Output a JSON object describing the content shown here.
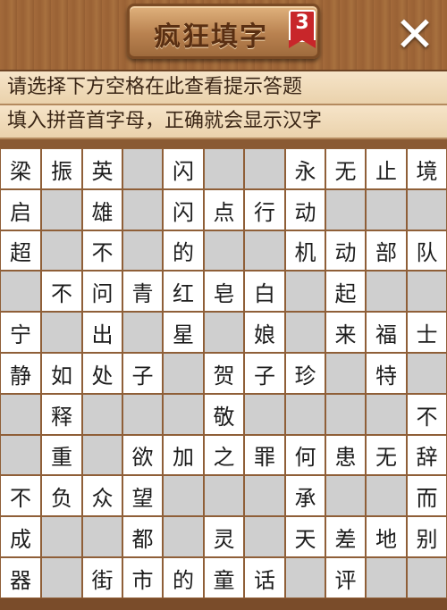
{
  "header": {
    "title": "疯狂填字",
    "level_badge": "3",
    "close_label": "✕"
  },
  "hints": {
    "line1": "请选择下方空格在此查看提示答题",
    "line2": "填入拼音首字母，正确就会显示汉字"
  },
  "colors": {
    "blank_cell": "#cfcfcf",
    "letter_cell": "#ffffff",
    "wood": "#8a5a33"
  },
  "grid": {
    "rows": [
      [
        "梁",
        "振",
        "英",
        "#",
        "闪",
        "#",
        "#",
        "永",
        "无",
        "止",
        "境"
      ],
      [
        "启",
        "#",
        "雄",
        "#",
        "闪",
        "点",
        "行",
        "动",
        "#",
        "#",
        "#"
      ],
      [
        "超",
        "#",
        "不",
        "#",
        "的",
        "#",
        "#",
        "机",
        "动",
        "部",
        "队"
      ],
      [
        "#",
        "不",
        "问",
        "青",
        "红",
        "皂",
        "白",
        "#",
        "起",
        "#",
        "#"
      ],
      [
        "宁",
        "#",
        "出",
        "#",
        "星",
        "#",
        "娘",
        "#",
        "来",
        "福",
        "士"
      ],
      [
        "静",
        "如",
        "处",
        "子",
        "#",
        "贺",
        "子",
        "珍",
        "#",
        "特",
        "#"
      ],
      [
        "#",
        "释",
        "#",
        "#",
        "#",
        "敬",
        "#",
        "#",
        "#",
        "#",
        "不"
      ],
      [
        "#",
        "重",
        "#",
        "欲",
        "加",
        "之",
        "罪",
        "何",
        "患",
        "无",
        "辞"
      ],
      [
        "不",
        "负",
        "众",
        "望",
        "#",
        "#",
        "#",
        "承",
        "#",
        "#",
        "而"
      ],
      [
        "成",
        "#",
        "#",
        "都",
        "#",
        "灵",
        "#",
        "天",
        "差",
        "地",
        "别"
      ],
      [
        "器",
        "#",
        "街",
        "市",
        "的",
        "童",
        "话",
        "#",
        "评",
        "#",
        "#"
      ]
    ]
  }
}
